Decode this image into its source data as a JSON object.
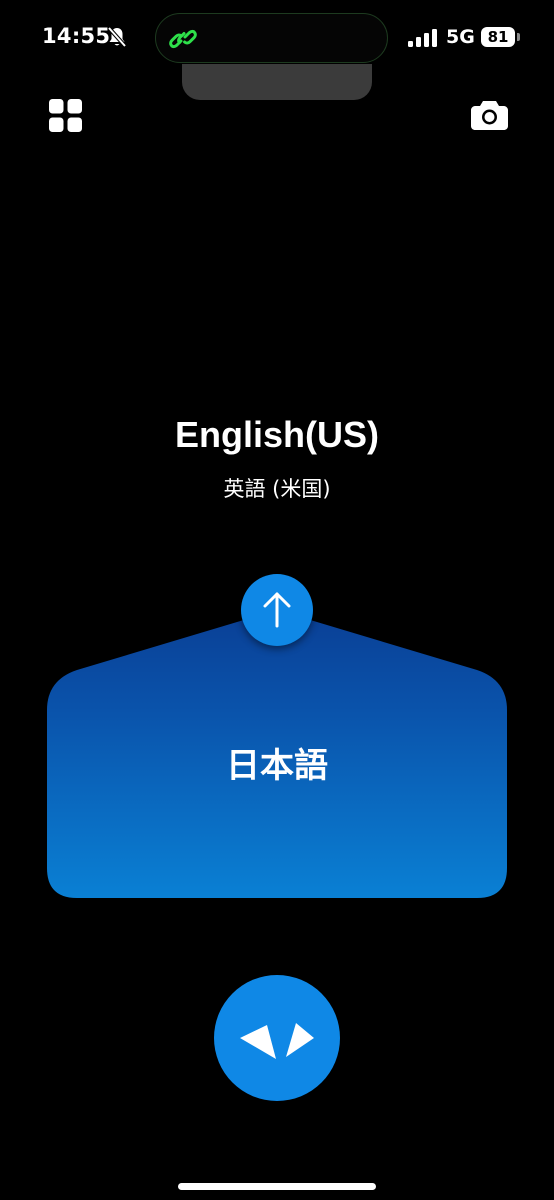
{
  "status_bar": {
    "time": "14:55",
    "network": "5G",
    "battery": "81",
    "silent_mode": true,
    "icons": [
      "bell-slash-icon",
      "link-icon",
      "signal-icon"
    ]
  },
  "toolbar": {
    "left_icon": "grid-icon",
    "right_icon": "camera-icon"
  },
  "translation": {
    "target_language": "English(US)",
    "target_language_native": "英語 (米国)",
    "source_language": "日本語",
    "swap_icon": "arrow-up-icon",
    "talk_icon": "talk-icon"
  },
  "colors": {
    "background": "#000000",
    "accent": "#0f88e6",
    "panel_top": "#0a4ea6",
    "panel_bottom": "#0a7ed4",
    "island_glow": "#2ee04a"
  }
}
